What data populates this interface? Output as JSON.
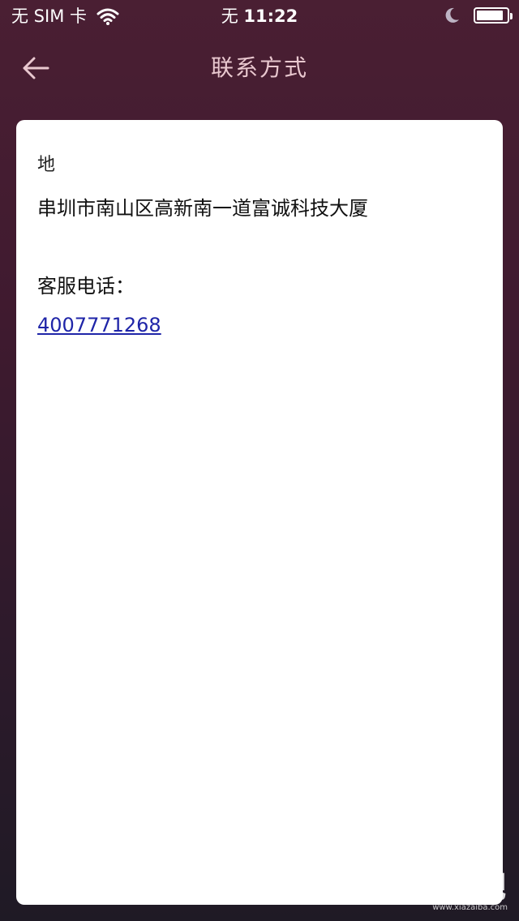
{
  "status_bar": {
    "carrier": "无 SIM 卡",
    "network": "无",
    "time": "11:22",
    "battery_level": 0.9
  },
  "nav": {
    "title": "联系方式",
    "back_icon": "arrow-left-icon"
  },
  "contact": {
    "address_label": "地",
    "address": "串圳市南山区高新南一道富诚科技大厦",
    "phone_label": "客服电话：",
    "phone": "4007771268"
  },
  "watermark": {
    "main": "下载吧",
    "sub": "www.xiazaiba.com"
  },
  "colors": {
    "nav_title": "#e9c8cf",
    "link": "#1f25a8",
    "card_bg": "#ffffff"
  }
}
